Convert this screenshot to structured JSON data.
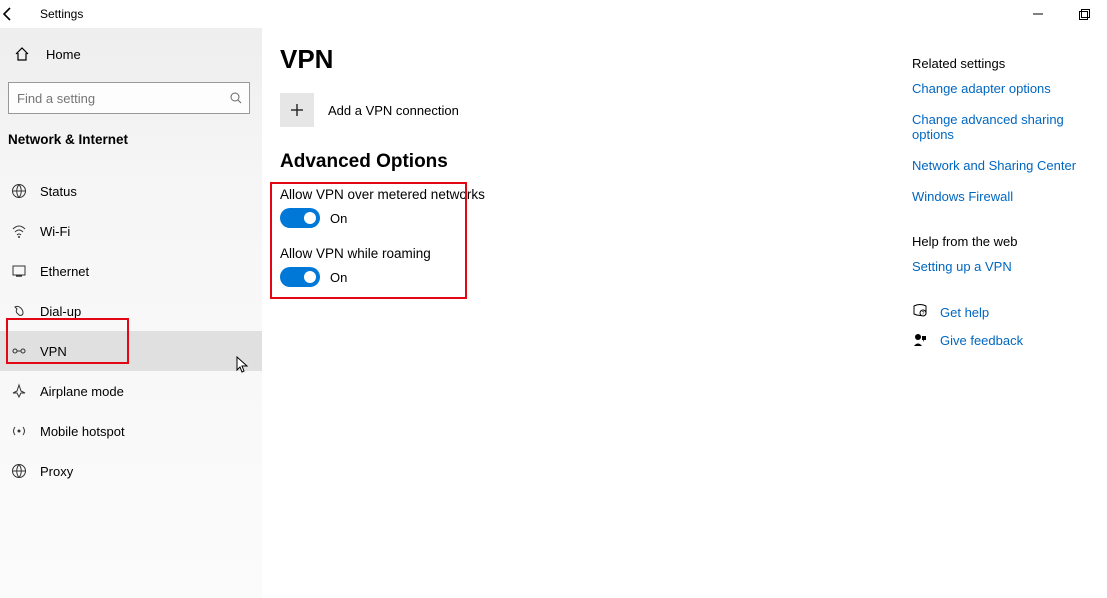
{
  "window": {
    "title": "Settings"
  },
  "sidebar": {
    "home": "Home",
    "search_placeholder": "Find a setting",
    "section": "Network & Internet",
    "items": [
      {
        "label": "Status"
      },
      {
        "label": "Wi-Fi"
      },
      {
        "label": "Ethernet"
      },
      {
        "label": "Dial-up"
      },
      {
        "label": "VPN"
      },
      {
        "label": "Airplane mode"
      },
      {
        "label": "Mobile hotspot"
      },
      {
        "label": "Proxy"
      }
    ]
  },
  "main": {
    "title": "VPN",
    "add_label": "Add a VPN connection",
    "advanced_header": "Advanced Options",
    "opt1_label": "Allow VPN over metered networks",
    "opt1_state": "On",
    "opt2_label": "Allow VPN while roaming",
    "opt2_state": "On"
  },
  "right": {
    "related_header": "Related settings",
    "links": [
      "Change adapter options",
      "Change advanced sharing options",
      "Network and Sharing Center",
      "Windows Firewall"
    ],
    "help_header": "Help from the web",
    "help_links": [
      "Setting up a VPN"
    ],
    "get_help": "Get help",
    "feedback": "Give feedback"
  }
}
